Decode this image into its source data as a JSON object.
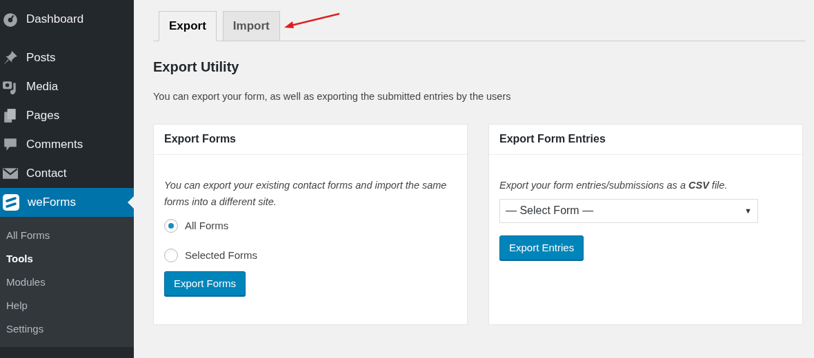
{
  "sidebar": {
    "menu": [
      {
        "label": "Dashboard",
        "selected": false
      },
      {
        "label": "Posts",
        "selected": false
      },
      {
        "label": "Media",
        "selected": false
      },
      {
        "label": "Pages",
        "selected": false
      },
      {
        "label": "Comments",
        "selected": false
      },
      {
        "label": "Contact",
        "selected": false
      },
      {
        "label": "weForms",
        "selected": true
      }
    ],
    "submenu": [
      {
        "label": "All Forms",
        "selected": false
      },
      {
        "label": "Tools",
        "selected": true
      },
      {
        "label": "Modules",
        "selected": false
      },
      {
        "label": "Help",
        "selected": false
      },
      {
        "label": "Settings",
        "selected": false
      }
    ]
  },
  "tabs": [
    {
      "label": "Export",
      "selected": true
    },
    {
      "label": "Import",
      "selected": false
    }
  ],
  "heading": "Export Utility",
  "description": "You can export your form, as well as exporting the submitted entries by the users",
  "cards": [
    {
      "title": "Export Forms",
      "text": "You can export your existing contact forms and import the same forms into a different site.",
      "options": [
        {
          "label": "All Forms",
          "selected": true
        },
        {
          "label": "Selected Forms",
          "selected": false
        }
      ],
      "button": "Export Forms"
    },
    {
      "title": "Export Form Entries",
      "text": "Export your form entries/submissions as a **CSV** file.",
      "select": {
        "value": "— Select Form —",
        "arrow": "▼"
      },
      "button": "Export Entries"
    }
  ]
}
